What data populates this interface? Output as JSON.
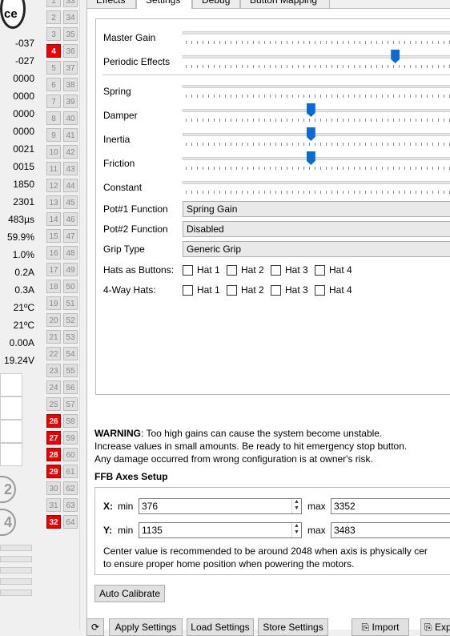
{
  "tabs": [
    "Effects",
    "Settings",
    "Debug",
    "Button Mapping"
  ],
  "logo_text": "ce",
  "telemetry": [
    "-037",
    "-027",
    "0000",
    "0000",
    "0000",
    "0000",
    "0021",
    "0015",
    "1850",
    "2301",
    "483µs",
    "59.9%",
    "1.0%",
    "0.2A",
    "0.3A",
    "21ºC",
    "21ºC",
    "0.00A",
    "19.24V"
  ],
  "side_circles": [
    "2",
    "4"
  ],
  "buttons": [
    {
      "a": "1",
      "b": "33"
    },
    {
      "a": "2",
      "b": "34"
    },
    {
      "a": "3",
      "b": "35"
    },
    {
      "a": "4",
      "b": "36",
      "on": true
    },
    {
      "a": "5",
      "b": "37"
    },
    {
      "a": "6",
      "b": "38"
    },
    {
      "a": "7",
      "b": "39"
    },
    {
      "a": "8",
      "b": "40"
    },
    {
      "a": "9",
      "b": "41"
    },
    {
      "a": "10",
      "b": "42"
    },
    {
      "a": "11",
      "b": "43"
    },
    {
      "a": "12",
      "b": "44"
    },
    {
      "a": "13",
      "b": "45"
    },
    {
      "a": "14",
      "b": "46"
    },
    {
      "a": "15",
      "b": "47"
    },
    {
      "a": "16",
      "b": "48"
    },
    {
      "a": "17",
      "b": "49"
    },
    {
      "a": "18",
      "b": "50"
    },
    {
      "a": "19",
      "b": "51"
    },
    {
      "a": "20",
      "b": "52"
    },
    {
      "a": "21",
      "b": "53"
    },
    {
      "a": "22",
      "b": "54"
    },
    {
      "a": "23",
      "b": "55"
    },
    {
      "a": "24",
      "b": "56"
    },
    {
      "a": "25",
      "b": "57"
    },
    {
      "a": "26",
      "b": "58",
      "on": true
    },
    {
      "a": "27",
      "b": "59",
      "on": true
    },
    {
      "a": "28",
      "b": "60",
      "on": true
    },
    {
      "a": "29",
      "b": "61",
      "on": true
    },
    {
      "a": "30",
      "b": "62"
    },
    {
      "a": "31",
      "b": "63"
    },
    {
      "a": "32",
      "b": "64",
      "on": true
    }
  ],
  "sliders": [
    {
      "label": "Master Gain",
      "level": null
    },
    {
      "label": "Periodic Effects",
      "level": 0.78
    },
    {
      "label": "Spring",
      "level": null
    },
    {
      "label": "Damper",
      "level": 0.47
    },
    {
      "label": "Inertia",
      "level": 0.47
    },
    {
      "label": "Friction",
      "level": 0.47
    },
    {
      "label": "Constant",
      "level": null
    }
  ],
  "pot1": {
    "label": "Pot#1 Function",
    "value": "Spring Gain"
  },
  "pot2": {
    "label": "Pot#2 Function",
    "value": "Disabled"
  },
  "grip": {
    "label": "Grip Type",
    "value": "Generic Grip"
  },
  "hats_buttons": {
    "label": "Hats as Buttons:",
    "items": [
      "Hat 1",
      "Hat 2",
      "Hat 3",
      "Hat 4"
    ]
  },
  "hats_4way": {
    "label": "4-Way Hats:",
    "items": [
      "Hat 1",
      "Hat 2",
      "Hat 3",
      "Hat 4"
    ]
  },
  "warning": {
    "bold": "WARNING",
    "line1": ": Too high gains can cause the system become unstable.",
    "line2": "Increase values in small amounts. Be ready to hit emergency stop button.",
    "line3": "Any damage occurred from wrong configuration is at owner's risk."
  },
  "ffb_title": "FFB Axes Setup",
  "axes": [
    {
      "axis": "X:",
      "min_label": "min",
      "min": "376",
      "max_label": "max",
      "max": "3352"
    },
    {
      "axis": "Y:",
      "min_label": "min",
      "min": "1135",
      "max_label": "max",
      "max": "3483"
    }
  ],
  "center_note": {
    "line1": "Center value is recommended to be around 2048 when axis is physically cer",
    "line2": "to ensure proper home position when powering the motors."
  },
  "auto_calibrate": "Auto Calibrate",
  "bottom_buttons": {
    "apply": "Apply Settings",
    "load": "Load Settings",
    "store": "Store Settings",
    "import": "Import",
    "export": "Exp"
  }
}
